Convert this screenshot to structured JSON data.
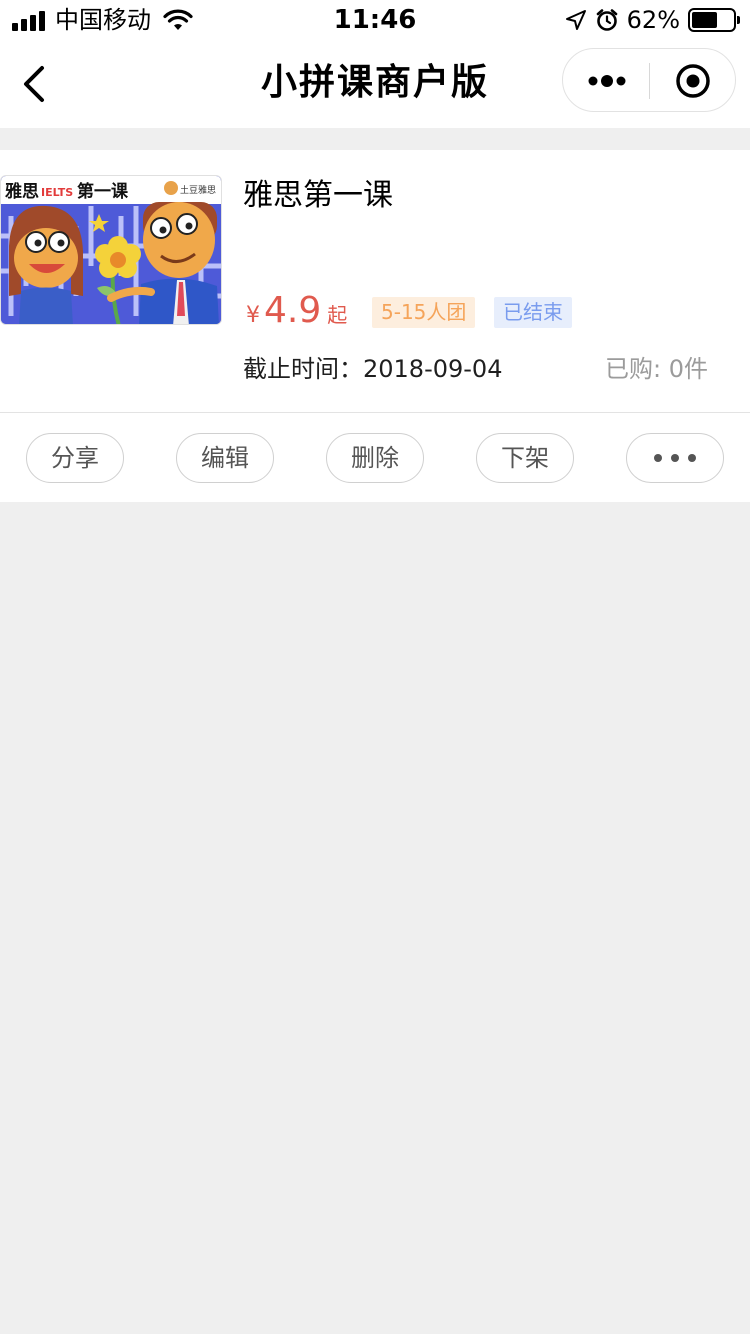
{
  "status_bar": {
    "carrier": "中国移动",
    "time": "11:46",
    "battery_percent_text": "62%",
    "battery_level": 0.62
  },
  "nav": {
    "title": "小拼课商户版"
  },
  "product": {
    "title": "雅思第一课",
    "price_currency": "¥",
    "price_value": "4.9",
    "price_suffix": "起",
    "group_tag": "5-15人团",
    "status_tag": "已结束",
    "deadline": "截止时间：2018-09-04",
    "purchased": "已购: 0件",
    "thumbnail": {
      "title_text": "雅思",
      "title_accent": "IELTS",
      "title_suffix": "第一课",
      "brand": "土豆雅思"
    }
  },
  "actions": {
    "share": "分享",
    "edit": "编辑",
    "delete": "删除",
    "unlist": "下架"
  },
  "colors": {
    "price": "#e05a4e",
    "group_tag_bg": "#fdeede",
    "group_tag_text": "#f5a45a",
    "status_tag_bg": "#e7eefc",
    "status_tag_text": "#7a9cee",
    "page_bg": "#efefef"
  },
  "icons": {
    "signal": "signal-icon",
    "wifi": "wifi-icon",
    "location": "location-arrow-icon",
    "alarm": "alarm-icon",
    "battery": "battery-icon",
    "back": "chevron-left-icon",
    "more": "more-dots-icon",
    "close_miniprogram": "target-circle-icon"
  }
}
